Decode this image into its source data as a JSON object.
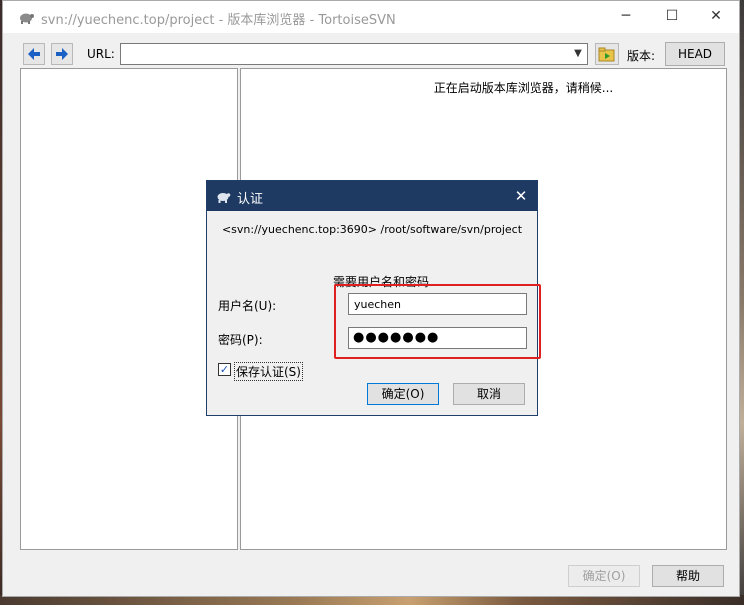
{
  "window": {
    "title": "svn://yuechenc.top/project - 版本库浏览器 - TortoiseSVN",
    "min_glyph": "─",
    "max_glyph": "☐",
    "close_glyph": "✕"
  },
  "toolbar": {
    "url_label": "URL:",
    "url_value": "",
    "revision_label": "版本:",
    "head_label": "HEAD"
  },
  "main": {
    "loading_text": "正在启动版本库浏览器，请稍候..."
  },
  "footer": {
    "ok_label": "确定(O)",
    "help_label": "帮助"
  },
  "dialog": {
    "title": "认证",
    "close_glyph": "✕",
    "url_text": "<svn://yuechenc.top:3690> /root/software/svn/project",
    "prompt": "需要用户名和密码",
    "username_label": "用户名(U):",
    "username_value": "yuechen",
    "password_label": "密码(P):",
    "password_dots": "●●●●●●●",
    "save_auth_label": "保存认证(S)",
    "save_auth_checked": true,
    "ok_label": "确定(O)",
    "cancel_label": "取消"
  },
  "colors": {
    "dialog_titlebar": "#1e3a62",
    "highlight": "#e02020",
    "nav_arrow": "#1a5fc4"
  },
  "icons": [
    "turtle-icon",
    "back-arrow-icon",
    "forward-arrow-icon",
    "go-folder-icon",
    "checkmark-icon"
  ]
}
